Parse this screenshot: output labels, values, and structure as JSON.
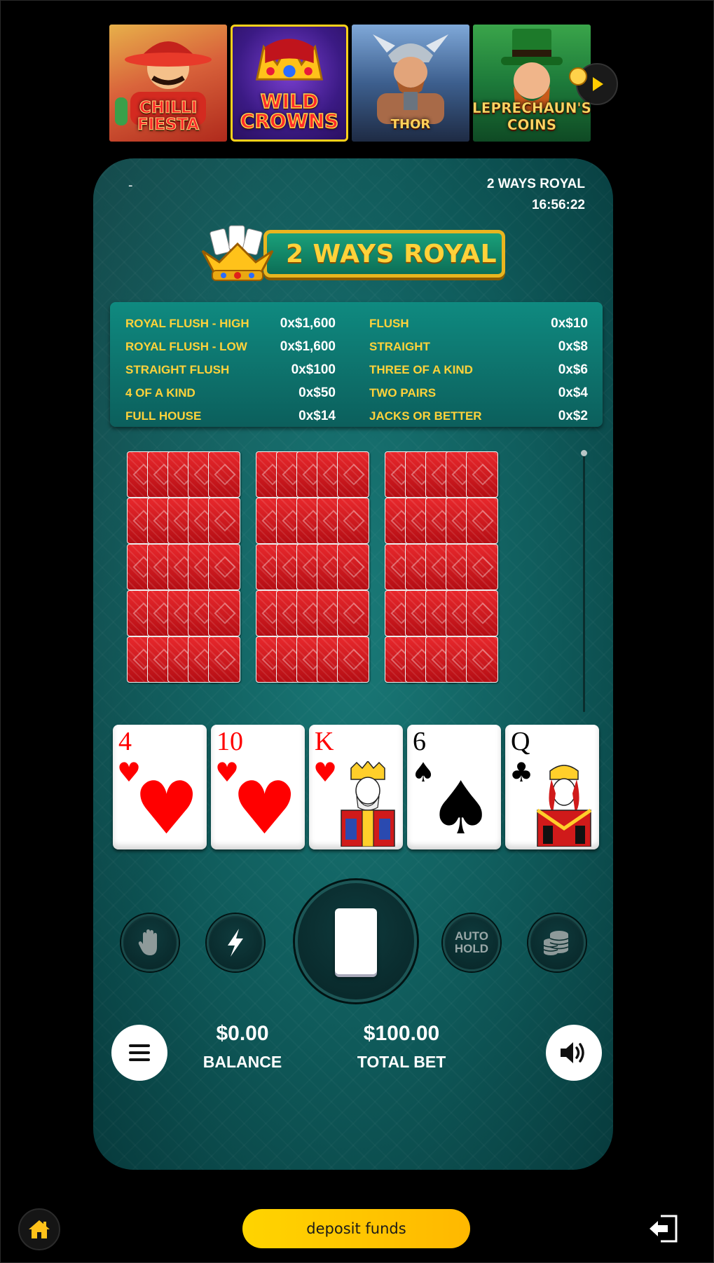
{
  "lobby": {
    "games": [
      {
        "title": "Chilli Fiesta"
      },
      {
        "title": "Wild Crowns"
      },
      {
        "title": "Thor"
      },
      {
        "title": "Leprechaun's Coins"
      }
    ]
  },
  "header": {
    "dash": "-",
    "game_name": "2 WAYS ROYAL",
    "time": "16:56:22"
  },
  "logo": {
    "text": "2 WAYS ROYAL"
  },
  "paytable": {
    "left": [
      {
        "name": "ROYAL FLUSH - HIGH",
        "value": "0x$1,600"
      },
      {
        "name": "ROYAL FLUSH - LOW",
        "value": "0x$1,600"
      },
      {
        "name": "STRAIGHT FLUSH",
        "value": "0x$100"
      },
      {
        "name": "4 OF A KIND",
        "value": "0x$50"
      },
      {
        "name": "FULL HOUSE",
        "value": "0x$14"
      }
    ],
    "right": [
      {
        "name": "FLUSH",
        "value": "0x$10"
      },
      {
        "name": "STRAIGHT",
        "value": "0x$8"
      },
      {
        "name": "THREE OF A KIND",
        "value": "0x$6"
      },
      {
        "name": "TWO PAIRS",
        "value": "0x$4"
      },
      {
        "name": "JACKS OR BETTER",
        "value": "0x$2"
      }
    ]
  },
  "hand": [
    {
      "rank": "4",
      "suit": "♥"
    },
    {
      "rank": "10",
      "suit": "♥"
    },
    {
      "rank": "K",
      "suit": "♥"
    },
    {
      "rank": "6",
      "suit": "♠"
    },
    {
      "rank": "Q",
      "suit": "♣"
    }
  ],
  "controls": {
    "auto_hold_line1": "AUTO",
    "auto_hold_line2": "HOLD"
  },
  "stats": {
    "balance_amount": "$0.00",
    "balance_label": "BALANCE",
    "bet_amount": "$100.00",
    "bet_label": "TOTAL BET"
  },
  "footer": {
    "deposit_label": "deposit funds"
  },
  "colors": {
    "accent": "#ffd23a",
    "felt": "#0f5a5a",
    "card_back": "#d01a20"
  },
  "icons": {
    "strip_next": "play-arrow-icon",
    "hold": "hand-icon",
    "turbo": "lightning-icon",
    "bet": "coins-stack-icon",
    "menu": "hamburger-icon",
    "sound": "speaker-icon",
    "home": "home-icon",
    "exit": "exit-icon"
  }
}
